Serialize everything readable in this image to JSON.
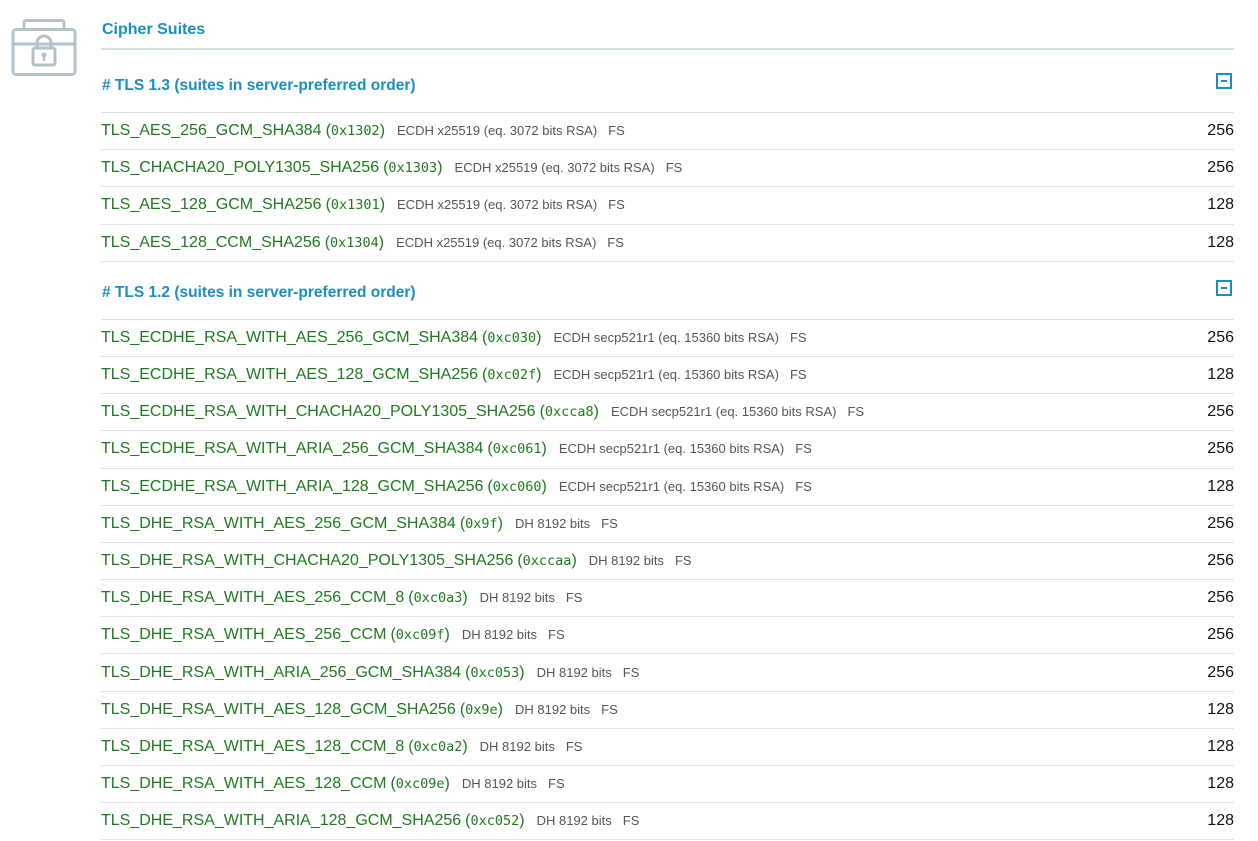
{
  "section": {
    "title": "Cipher Suites",
    "icon": "lock-briefcase-icon"
  },
  "colors": {
    "accent": "#1a8fbf",
    "suite_name": "#1e7a1e",
    "meta_text": "#555555"
  },
  "groups": [
    {
      "header": "# TLS 1.3 (suites in server-preferred order)",
      "toggle_icon": "collapse-minus-icon",
      "suites": [
        {
          "name": "TLS_AES_256_GCM_SHA384",
          "open": "(",
          "code": "0x1302",
          "close": ")",
          "kx": "ECDH x25519 (eq. 3072 bits RSA)",
          "fs": "FS",
          "bits": "256"
        },
        {
          "name": "TLS_CHACHA20_POLY1305_SHA256",
          "open": "(",
          "code": "0x1303",
          "close": ")",
          "kx": "ECDH x25519 (eq. 3072 bits RSA)",
          "fs": "FS",
          "bits": "256"
        },
        {
          "name": "TLS_AES_128_GCM_SHA256",
          "open": "(",
          "code": "0x1301",
          "close": ")",
          "kx": "ECDH x25519 (eq. 3072 bits RSA)",
          "fs": "FS",
          "bits": "128"
        },
        {
          "name": "TLS_AES_128_CCM_SHA256",
          "open": "(",
          "code": "0x1304",
          "close": ")",
          "kx": "ECDH x25519 (eq. 3072 bits RSA)",
          "fs": "FS",
          "bits": "128"
        }
      ]
    },
    {
      "header": "# TLS 1.2 (suites in server-preferred order)",
      "toggle_icon": "collapse-minus-icon",
      "suites": [
        {
          "name": "TLS_ECDHE_RSA_WITH_AES_256_GCM_SHA384",
          "open": "(",
          "code": "0xc030",
          "close": ")",
          "kx": "ECDH secp521r1 (eq. 15360 bits RSA)",
          "fs": "FS",
          "bits": "256"
        },
        {
          "name": "TLS_ECDHE_RSA_WITH_AES_128_GCM_SHA256",
          "open": "(",
          "code": "0xc02f",
          "close": ")",
          "kx": "ECDH secp521r1 (eq. 15360 bits RSA)",
          "fs": "FS",
          "bits": "128"
        },
        {
          "name": "TLS_ECDHE_RSA_WITH_CHACHA20_POLY1305_SHA256",
          "open": "(",
          "code": "0xcca8",
          "close": ")",
          "kx": "ECDH secp521r1 (eq. 15360 bits RSA)",
          "fs": "FS",
          "bits": "256"
        },
        {
          "name": "TLS_ECDHE_RSA_WITH_ARIA_256_GCM_SHA384",
          "open": "(",
          "code": "0xc061",
          "close": ")",
          "kx": "ECDH secp521r1 (eq. 15360 bits RSA)",
          "fs": "FS",
          "bits": "256"
        },
        {
          "name": "TLS_ECDHE_RSA_WITH_ARIA_128_GCM_SHA256",
          "open": "(",
          "code": "0xc060",
          "close": ")",
          "kx": "ECDH secp521r1 (eq. 15360 bits RSA)",
          "fs": "FS",
          "bits": "128"
        },
        {
          "name": "TLS_DHE_RSA_WITH_AES_256_GCM_SHA384",
          "open": "(",
          "code": "0x9f",
          "close": ")",
          "kx": "DH 8192 bits",
          "fs": "FS",
          "bits": "256"
        },
        {
          "name": "TLS_DHE_RSA_WITH_CHACHA20_POLY1305_SHA256",
          "open": "(",
          "code": "0xccaa",
          "close": ")",
          "kx": "DH 8192 bits",
          "fs": "FS",
          "bits": "256"
        },
        {
          "name": "TLS_DHE_RSA_WITH_AES_256_CCM_8",
          "open": "(",
          "code": "0xc0a3",
          "close": ")",
          "kx": "DH 8192 bits",
          "fs": "FS",
          "bits": "256"
        },
        {
          "name": "TLS_DHE_RSA_WITH_AES_256_CCM",
          "open": "(",
          "code": "0xc09f",
          "close": ")",
          "kx": "DH 8192 bits",
          "fs": "FS",
          "bits": "256"
        },
        {
          "name": "TLS_DHE_RSA_WITH_ARIA_256_GCM_SHA384",
          "open": "(",
          "code": "0xc053",
          "close": ")",
          "kx": "DH 8192 bits",
          "fs": "FS",
          "bits": "256"
        },
        {
          "name": "TLS_DHE_RSA_WITH_AES_128_GCM_SHA256",
          "open": "(",
          "code": "0x9e",
          "close": ")",
          "kx": "DH 8192 bits",
          "fs": "FS",
          "bits": "128"
        },
        {
          "name": "TLS_DHE_RSA_WITH_AES_128_CCM_8",
          "open": "(",
          "code": "0xc0a2",
          "close": ")",
          "kx": "DH 8192 bits",
          "fs": "FS",
          "bits": "128"
        },
        {
          "name": "TLS_DHE_RSA_WITH_AES_128_CCM",
          "open": "(",
          "code": "0xc09e",
          "close": ")",
          "kx": "DH 8192 bits",
          "fs": "FS",
          "bits": "128"
        },
        {
          "name": "TLS_DHE_RSA_WITH_ARIA_128_GCM_SHA256",
          "open": "(",
          "code": "0xc052",
          "close": ")",
          "kx": "DH 8192 bits",
          "fs": "FS",
          "bits": "128"
        }
      ]
    }
  ]
}
